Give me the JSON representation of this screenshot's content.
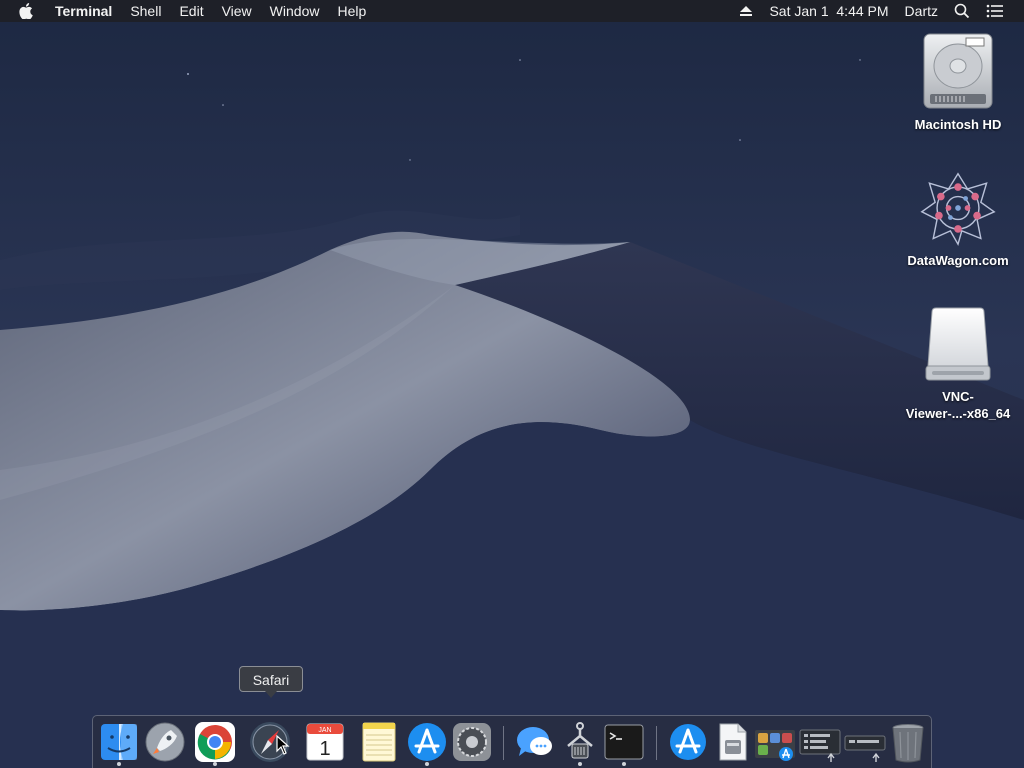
{
  "menubar": {
    "app_name": "Terminal",
    "menus": [
      "Shell",
      "Edit",
      "View",
      "Window",
      "Help"
    ],
    "clock": "Sat Jan 1  4:44 PM",
    "user": "Dartz"
  },
  "desktop_icons": {
    "hd_label": "Macintosh HD",
    "datawagon_label": "DataWagon.com",
    "vnc_label_line1": "VNC-",
    "vnc_label_line2": "Viewer-...-x86_64"
  },
  "tooltip": "Safari",
  "dock": {
    "calendar_month": "JAN",
    "calendar_day": "1",
    "items": [
      "Finder",
      "Launchpad",
      "Google Chrome",
      "Safari",
      "Calendar",
      "Notes",
      "App Store",
      "System Preferences",
      "Messages",
      "Network Utility",
      "Terminal",
      "App Store",
      "Installer",
      "Applications Stack",
      "Documents Stack",
      "Downloads Stack",
      "Trash"
    ]
  },
  "colors": {
    "menubar_bg": "#1e1e22",
    "wallpaper_sky": "#26324f",
    "dune_light": "#7e8598",
    "dune_dark": "#2b3149"
  }
}
